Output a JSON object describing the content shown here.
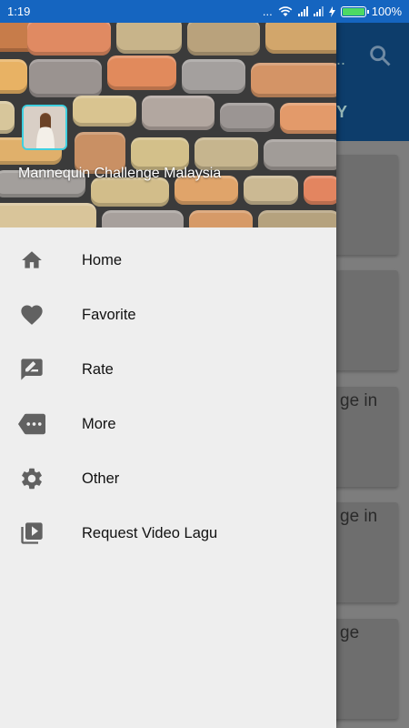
{
  "status_bar": {
    "time": "1:19",
    "dots": "...",
    "battery_text": "100%"
  },
  "drawer": {
    "header_title": "Mannequin Challenge Malaysia",
    "menu": [
      {
        "label": "Home",
        "icon": "home-icon"
      },
      {
        "label": "Favorite",
        "icon": "heart-icon"
      },
      {
        "label": "Rate",
        "icon": "rate-review-icon"
      },
      {
        "label": "More",
        "icon": "more-tag-icon"
      },
      {
        "label": "Other",
        "icon": "gear-icon"
      },
      {
        "label": "Request Video Lagu",
        "icon": "video-library-icon"
      }
    ]
  },
  "background": {
    "toolbar_dots": "...",
    "tab_label": "Y",
    "cards": [
      {
        "text": ""
      },
      {
        "text": ""
      },
      {
        "text": "ge in"
      },
      {
        "text": "ge in"
      },
      {
        "text": "ge"
      }
    ]
  },
  "colors": {
    "status_bar": "#1565c0",
    "toolbar": "#0d3d6b",
    "drawer_bg": "#eeeeee",
    "icon": "#616161"
  }
}
